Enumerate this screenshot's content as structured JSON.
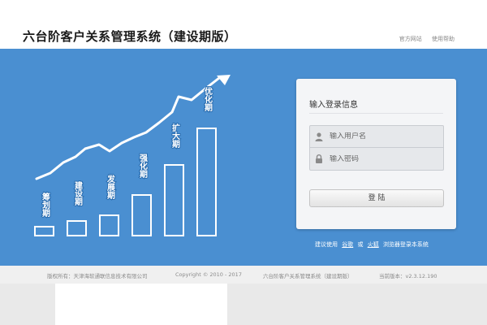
{
  "header": {
    "title": "六台阶客户关系管理系统（建设期版）",
    "links": [
      "官方网站",
      "使用帮助"
    ]
  },
  "stages": [
    "筹划期",
    "建设期",
    "发展期",
    "强化期",
    "扩大期",
    "优化期"
  ],
  "login": {
    "title": "输入登录信息",
    "username_placeholder": "输入用户名",
    "password_placeholder": "输入密码",
    "button_label": "登 陆"
  },
  "browser_hint": {
    "prefix": "建议使用",
    "browser1": "谷歌",
    "or": "或",
    "browser2": "火狐",
    "suffix": "浏览器登录本系统"
  },
  "footer": {
    "owner": "版权所有：天津海软通联信息技术有限公司",
    "copyright": "Copyright © 2010 - 2017",
    "system_name": "六台阶客户关系管理系统（建设期版）",
    "version": "当前版本：v2.3.12.190"
  },
  "colors": {
    "banner": "#4a8fd1",
    "footer": "#f0f0f0"
  },
  "icons": [
    "user-icon",
    "lock-icon",
    "arrow-up-right-icon"
  ]
}
